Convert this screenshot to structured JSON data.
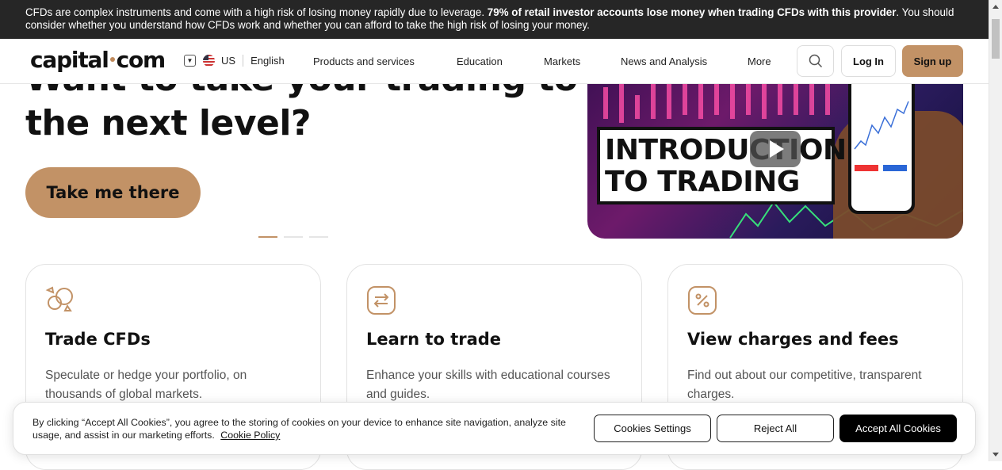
{
  "risk_banner": {
    "text_before": "CFDs are complex instruments and come with a high risk of losing money rapidly due to leverage. ",
    "text_bold": "79% of retail investor accounts lose money when trading CFDs with this provider",
    "text_after": ". You should consider whether you understand how CFDs work and whether you can afford to take the high risk of losing your money."
  },
  "header": {
    "logo_left": "capital",
    "logo_right": "com",
    "region": "US",
    "language": "English",
    "nav": [
      "Products and services",
      "Education",
      "Markets",
      "News and Analysis",
      "More"
    ],
    "login": "Log In",
    "signup": "Sign up"
  },
  "hero": {
    "title_line1": "Want to take your trading to",
    "title_line2": "the next level?",
    "cta": "Take me there",
    "video_text_line1": "INTRODUCTION",
    "video_text_line2": "TO TRADING",
    "carousel_active": 1,
    "carousel_count": 3
  },
  "cards": [
    {
      "title": "Trade CFDs",
      "desc": "Speculate or hedge your portfolio, on thousands of global markets.",
      "icon": "shapes-icon"
    },
    {
      "title": "Learn to trade",
      "desc": "Enhance your skills with educational courses and guides.",
      "icon": "exchange-arrows-icon"
    },
    {
      "title": "View charges and fees",
      "desc": "Find out about our competitive, transparent charges.",
      "icon": "percent-icon"
    }
  ],
  "cookie": {
    "text": "By clicking “Accept All Cookies”, you agree to the storing of cookies on your device to enhance site navigation, analyze site usage, and assist in our marketing efforts.",
    "policy_link": "Cookie Policy",
    "settings": "Cookies Settings",
    "reject": "Reject All",
    "accept": "Accept All Cookies"
  },
  "colors": {
    "accent": "#c29266",
    "banner_bg": "#262626"
  }
}
